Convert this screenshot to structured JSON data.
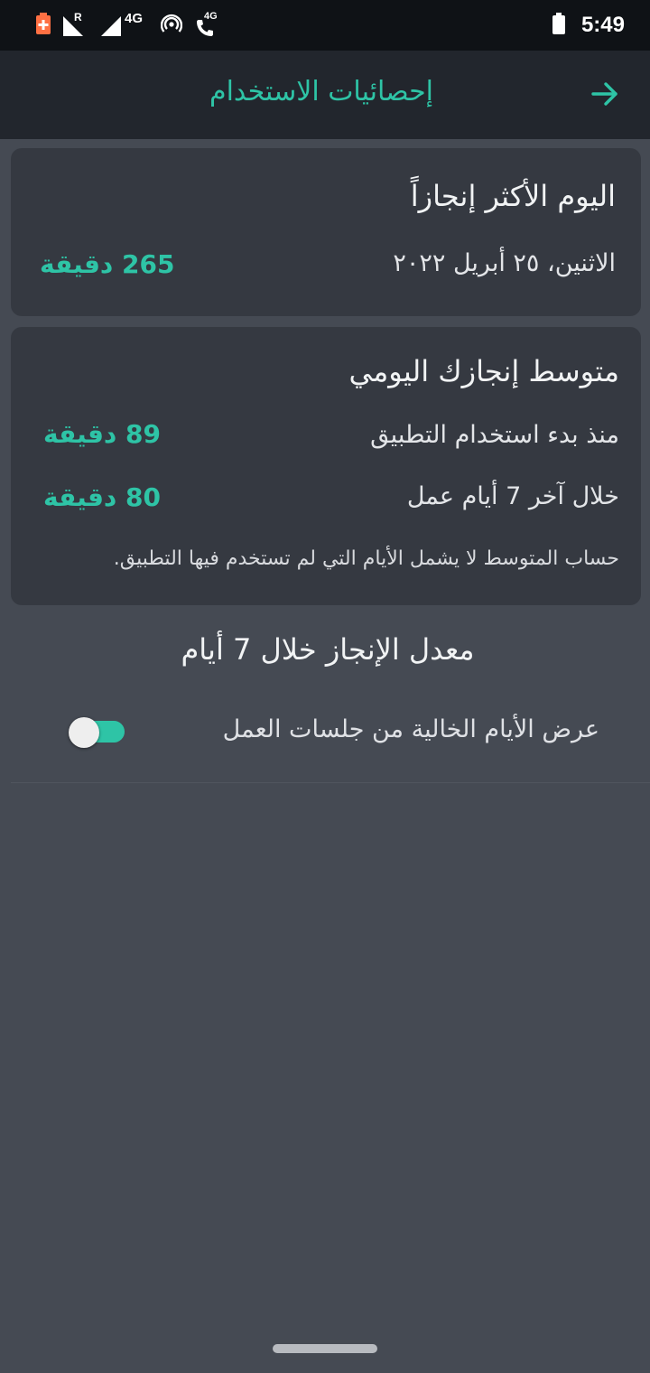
{
  "status_bar": {
    "time": "5:49",
    "network_label": "4G",
    "roaming_label": "R",
    "call_label": "4G",
    "icons": [
      "battery-saver-icon",
      "signal-roaming-icon",
      "signal-icon",
      "hotspot-icon",
      "volte-call-icon",
      "battery-icon"
    ]
  },
  "app_bar": {
    "title": "إحصائيات الاستخدام",
    "back_icon": "arrow-forward-icon"
  },
  "most_productive_day": {
    "title": "اليوم الأكثر إنجازاً",
    "date": "الاثنين، ٢٥ أبريل ٢٠٢٢",
    "value": "265 دقيقة"
  },
  "daily_average": {
    "title": "متوسط إنجازك اليومي",
    "since_start_label": "منذ بدء استخدام التطبيق",
    "since_start_value": "89 دقيقة",
    "last_7_label": "خلال آخر 7 أيام عمل",
    "last_7_value": "80 دقيقة",
    "note": "حساب المتوسط لا يشمل الأيام التي لم تستخدم فيها التطبيق."
  },
  "weekly_rate": {
    "title": "معدل الإنجاز خلال 7 أيام",
    "toggle_label": "عرض الأيام الخالية من جلسات العمل",
    "toggle_on": true
  },
  "colors": {
    "accent": "#2ec4a6",
    "background": "#454a53",
    "card": "#353941",
    "app_bar": "#22262d",
    "status_bar": "#0f1216"
  }
}
